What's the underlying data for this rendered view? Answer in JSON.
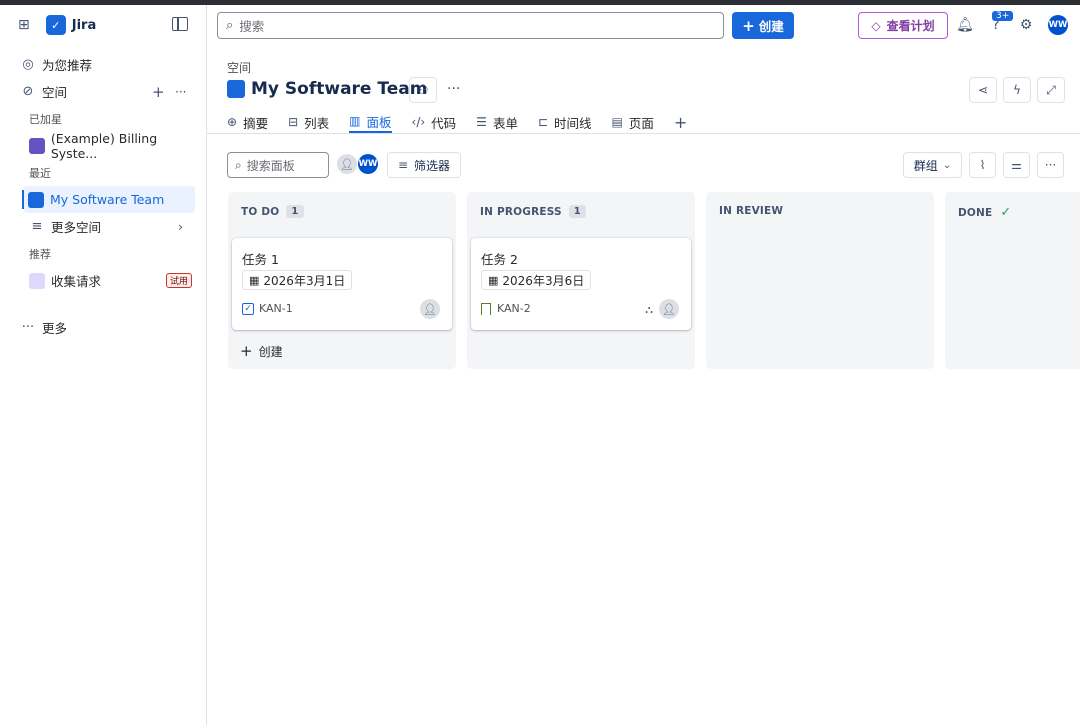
{
  "app": {
    "name": "Jira"
  },
  "sidebar": {
    "for_you": "为您推荐",
    "spaces": "空间",
    "starred_header": "已加星",
    "starred": [
      {
        "label": "(Example) Billing Syste..."
      }
    ],
    "recent_header": "最近",
    "recent": [
      {
        "label": "My Software Team"
      }
    ],
    "more_spaces": "更多空间",
    "recommended_header": "推荐",
    "recommended": [
      {
        "label": "收集请求",
        "badge": "试用"
      }
    ],
    "more": "更多"
  },
  "topbar": {
    "search_placeholder": "搜索",
    "create_label": "创建",
    "plan_label": "查看计划",
    "notif_count": "3+",
    "user_initials": "WW"
  },
  "header": {
    "breadcrumb": "空间",
    "title": "My Software Team"
  },
  "tabs": [
    {
      "label": "摘要",
      "icon": "globe-icon"
    },
    {
      "label": "列表",
      "icon": "table-icon"
    },
    {
      "label": "面板",
      "icon": "board-icon",
      "active": true
    },
    {
      "label": "代码",
      "icon": "code-icon"
    },
    {
      "label": "表单",
      "icon": "form-icon"
    },
    {
      "label": "时间线",
      "icon": "timeline-icon"
    },
    {
      "label": "页面",
      "icon": "page-icon"
    }
  ],
  "board": {
    "search_placeholder": "搜索面板",
    "filter_label": "筛选器",
    "group_label": "群组",
    "user_initials": "WW",
    "create_label": "创建",
    "columns": [
      {
        "name": "TO DO",
        "count": "1"
      },
      {
        "name": "IN PROGRESS",
        "count": "1"
      },
      {
        "name": "IN REVIEW"
      },
      {
        "name": "DONE"
      }
    ],
    "cards": [
      {
        "title": "任务 1",
        "date": "2026年3月1日",
        "key": "KAN-1"
      },
      {
        "title": "任务 2",
        "date": "2026年3月6日",
        "key": "KAN-2"
      }
    ]
  },
  "colors": {
    "accent": "#1868db",
    "plan": "#af59e1",
    "done": "#22a06b"
  }
}
